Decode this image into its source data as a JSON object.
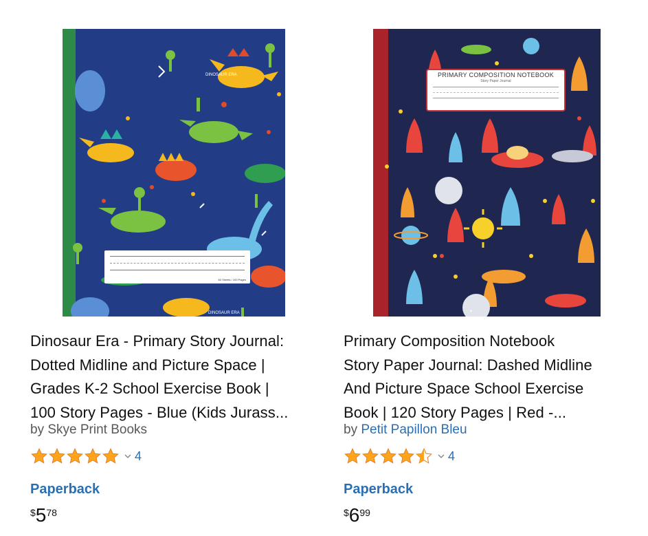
{
  "products": [
    {
      "title_lines": [
        "Dinosaur Era - Primary Story Journal:",
        "Dotted Midline and Picture Space |",
        "Grades K-2 School Exercise Book |",
        "100 Story Pages - Blue (Kids Jurass..."
      ],
      "by_prefix": "by ",
      "author": "Skye Print Books",
      "rating": 5,
      "rating_count": "4",
      "format": "Paperback",
      "price": {
        "symbol": "$",
        "whole": "5",
        "fraction": "78"
      },
      "cover": {
        "text_top": "DINOSAUR ERA",
        "text_bottom": "DINOSAUR ERA",
        "label_note": "60 Sheets / 100 Pages",
        "background": "#223d86",
        "spine_color": "#2e8a47"
      }
    },
    {
      "title_lines": [
        "Primary Composition Notebook",
        "Story Paper Journal: Dashed Midline",
        "And Picture Space School Exercise",
        "Book | 120 Story Pages | Red -..."
      ],
      "by_prefix": "by ",
      "author": "Petit Papillon Bleu",
      "rating": 4.5,
      "rating_count": "4",
      "format": "Paperback",
      "price": {
        "symbol": "$",
        "whole": "6",
        "fraction": "99"
      },
      "cover": {
        "title": "PRIMARY COMPOSITION NOTEBOOK",
        "subtitle": "Story Paper Journal",
        "background": "#1f2750",
        "spine_color": "#a8242a"
      }
    }
  ],
  "colors": {
    "link": "#2a6fb3",
    "star": "#ffa41c",
    "text": "#0f1111",
    "muted": "#565959"
  }
}
